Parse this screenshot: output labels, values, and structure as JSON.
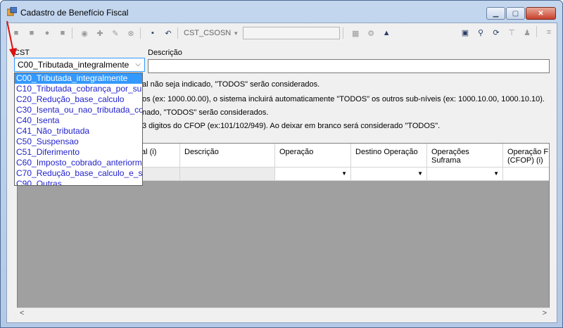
{
  "window": {
    "title": "Cadastro de Benefício Fiscal"
  },
  "toolbar": {
    "cst_csosn_label": "CST_CSOSN"
  },
  "form": {
    "cst_label": "CST",
    "cst_value": "C00_Tributada_integralmente",
    "descricao_label": "Descrição",
    "descricao_value": ""
  },
  "info_lines": [
    "al não seja indicado, \"TODOS\" serão considerados.",
    "os (ex: 1000.00.00), o sistema incluirá automaticamente \"TODOS\" os outros sub-níveis (ex: 1000.10.00, 1000.10.10).",
    "nado, \"TODOS\" serão considerados.",
    "3 digitos do CFOP (ex:101/102/949). Ao deixar em branco será considerado \"TODOS\"."
  ],
  "grid": {
    "columns": [
      "al (i)",
      "Descrição",
      "Operação",
      "Destino Operação",
      "Operações Suframa",
      "Operação F (CFOP) (i)"
    ]
  },
  "dropdown": {
    "options": [
      "C00_Tributada_integralmente",
      "C10_Tributada_cobrança_por_su",
      "C20_Redução_base_calculo",
      "C30_Isenta_ou_nao_tributada_co",
      "C40_Isenta",
      "C41_Não_tributada",
      "C50_Suspensao",
      "C51_Diferimento",
      "C60_Imposto_cobrado_anteriorm",
      "C70_Redução_base_calculo_e_s",
      "C90_Outras"
    ],
    "selected_index": 0
  },
  "colors": {
    "annotation_arrow": "#e01010",
    "selection": "#3399ff"
  }
}
